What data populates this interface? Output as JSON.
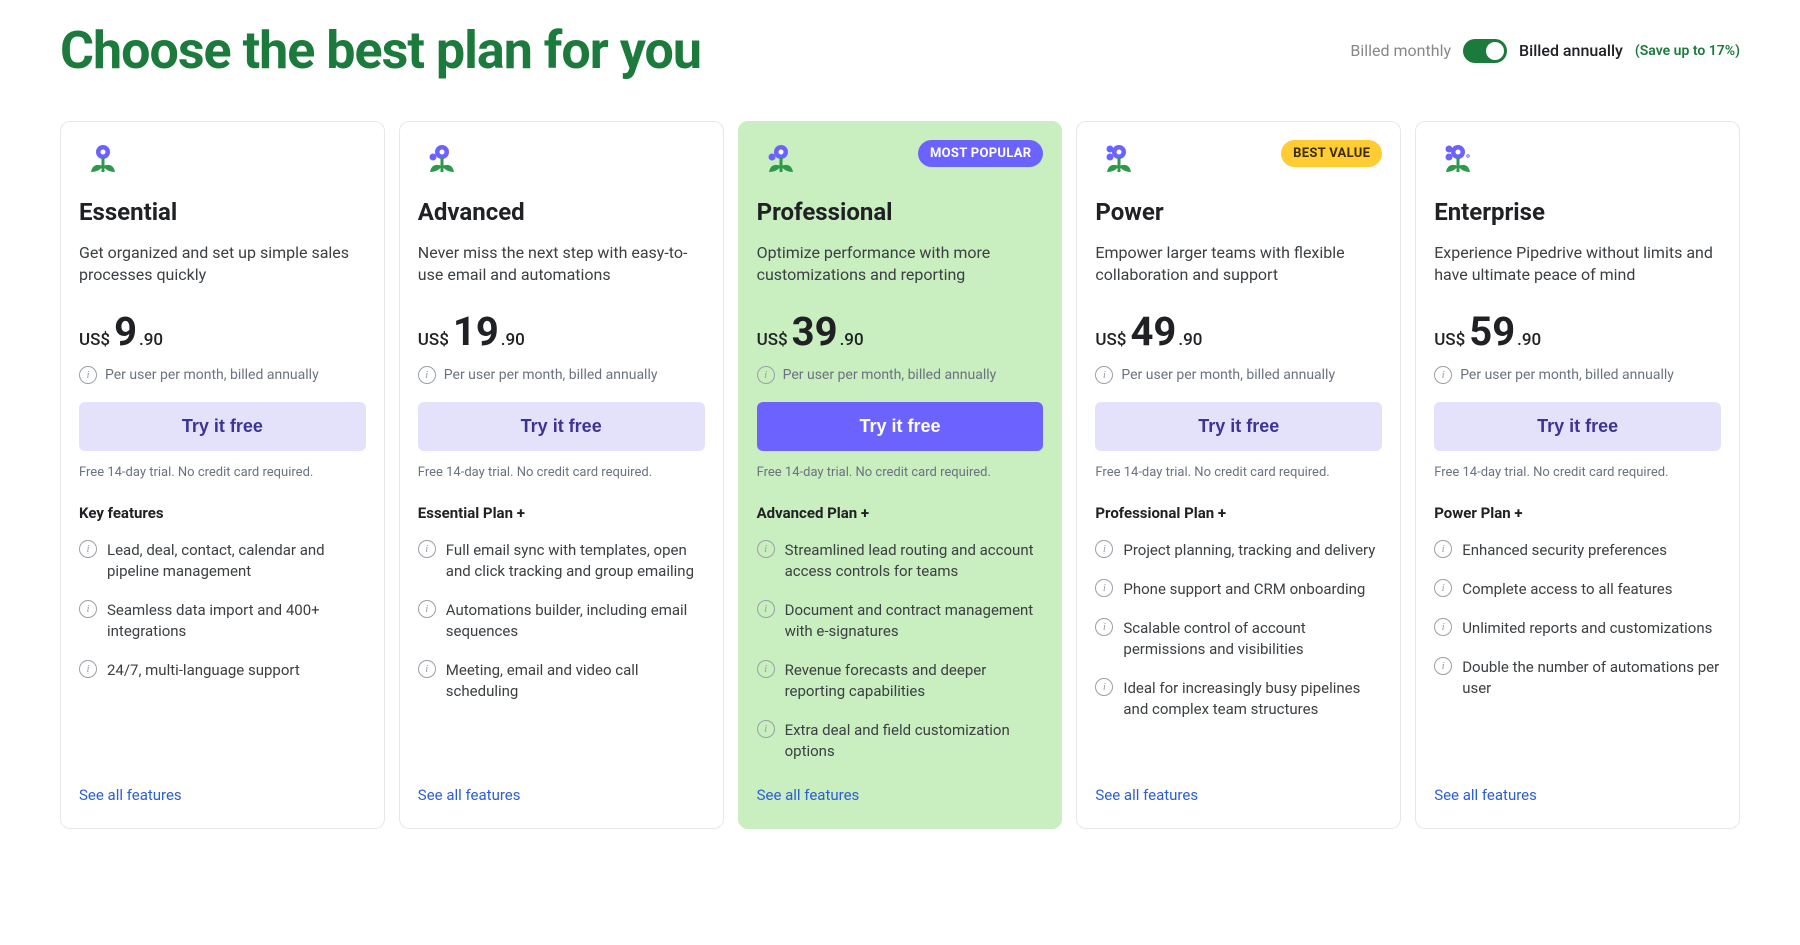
{
  "header": {
    "title": "Choose the best plan for you",
    "billing_monthly_label": "Billed monthly",
    "billing_annual_label": "Billed annually",
    "billing_save_label": "(Save up to 17%)"
  },
  "common": {
    "currency": "US$",
    "price_note": "Per user per month, billed annually",
    "cta_label": "Try it free",
    "trial_note": "Free 14-day trial. No credit card required.",
    "see_all_label": "See all features"
  },
  "plans": [
    {
      "name": "Essential",
      "desc": "Get organized and set up simple sales processes quickly",
      "price_major": "9",
      "price_minor": ".90",
      "features_heading": "Key features",
      "features": [
        "Lead, deal, contact, calendar and pipeline management",
        "Seamless data import and 400+ integrations",
        "24/7, multi-language support"
      ]
    },
    {
      "name": "Advanced",
      "desc": "Never miss the next step with easy-to-use email and automations",
      "price_major": "19",
      "price_minor": ".90",
      "features_heading": "Essential Plan +",
      "features": [
        "Full email sync with templates, open and click tracking and group emailing",
        "Automations builder, including email sequences",
        "Meeting, email and video call scheduling"
      ]
    },
    {
      "name": "Professional",
      "desc": "Optimize performance with more customizations and reporting",
      "price_major": "39",
      "price_minor": ".90",
      "badge": "MOST POPULAR",
      "features_heading": "Advanced Plan +",
      "features": [
        "Streamlined lead routing and account access controls for teams",
        "Document and contract management with e-signatures",
        "Revenue forecasts and deeper reporting capabilities",
        "Extra deal and field customization options"
      ]
    },
    {
      "name": "Power",
      "desc": "Empower larger teams with flexible collaboration and support",
      "price_major": "49",
      "price_minor": ".90",
      "badge": "BEST VALUE",
      "features_heading": "Professional Plan +",
      "features": [
        "Project planning, tracking and delivery",
        "Phone support and CRM onboarding",
        "Scalable control of account permissions and visibilities",
        "Ideal for increasingly busy pipelines and complex team structures"
      ]
    },
    {
      "name": "Enterprise",
      "desc": "Experience Pipedrive without limits and have ultimate peace of mind",
      "price_major": "59",
      "price_minor": ".90",
      "features_heading": "Power Plan +",
      "features": [
        "Enhanced security preferences",
        "Complete access to all features",
        "Unlimited reports and customizations",
        "Double the number of automations per user"
      ]
    }
  ]
}
